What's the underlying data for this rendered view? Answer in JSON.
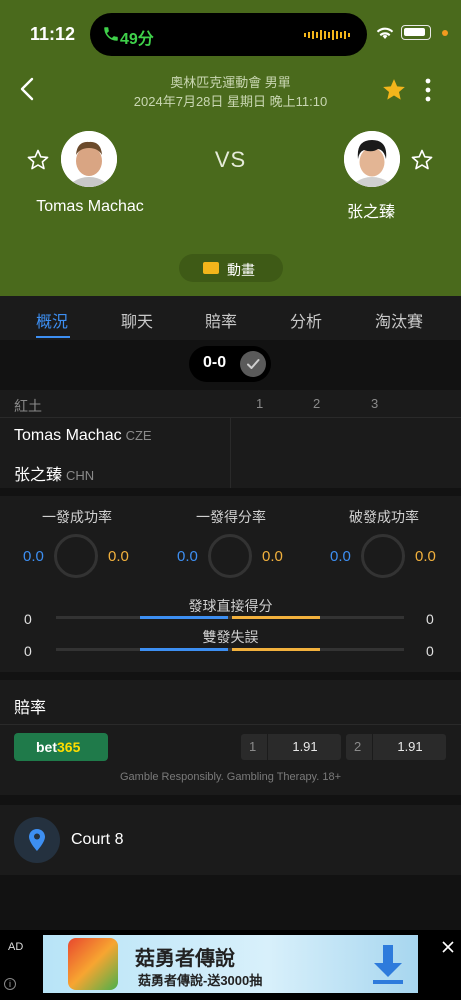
{
  "status_bar": {
    "time": "11:12",
    "call_timer": "49分"
  },
  "header": {
    "match_title": "奧林匹克運動會 男單",
    "match_date": "2024年7月28日 星期日 晚上11:10",
    "vs": "VS",
    "player1": {
      "name": "Tomas Machac"
    },
    "player2": {
      "name": "张之臻"
    },
    "animation_button": "動畫"
  },
  "tabs": [
    {
      "label": "概況",
      "active": true
    },
    {
      "label": "聊天",
      "active": false
    },
    {
      "label": "賠率",
      "active": false
    },
    {
      "label": "分析",
      "active": false
    },
    {
      "label": "淘汰賽",
      "active": false
    }
  ],
  "score": {
    "text": "0-0"
  },
  "score_table": {
    "surface": "紅土",
    "sets": [
      "1",
      "2",
      "3"
    ],
    "rows": [
      {
        "name": "Tomas Machac",
        "country": "CZE"
      },
      {
        "name": "张之臻",
        "country": "CHN"
      }
    ]
  },
  "serve_stats": {
    "rings": [
      {
        "label": "一發成功率",
        "p1": "0.0",
        "p2": "0.0"
      },
      {
        "label": "一發得分率",
        "p1": "0.0",
        "p2": "0.0"
      },
      {
        "label": "破發成功率",
        "p1": "0.0",
        "p2": "0.0"
      }
    ],
    "bars": [
      {
        "label": "發球直接得分",
        "p1": "0",
        "p2": "0"
      },
      {
        "label": "雙發失誤",
        "p1": "0",
        "p2": "0"
      }
    ]
  },
  "odds": {
    "title": "賠率",
    "bookmaker_a": "bet",
    "bookmaker_b": "365",
    "options": [
      {
        "index": "1",
        "value": "1.91"
      },
      {
        "index": "2",
        "value": "1.91"
      }
    ],
    "disclaimer": "Gamble Responsibly. Gambling Therapy. 18+"
  },
  "venue": {
    "name": "Court 8"
  },
  "ad": {
    "label": "AD",
    "info": "i",
    "title": "菇勇者傳說",
    "subtitle": "菇勇者傳說-送3000抽"
  },
  "colors": {
    "header_bg": "#4a6a1c",
    "accent_blue": "#3d8ff2",
    "accent_orange": "#f2b13d",
    "fav_star": "#f2b51b"
  }
}
